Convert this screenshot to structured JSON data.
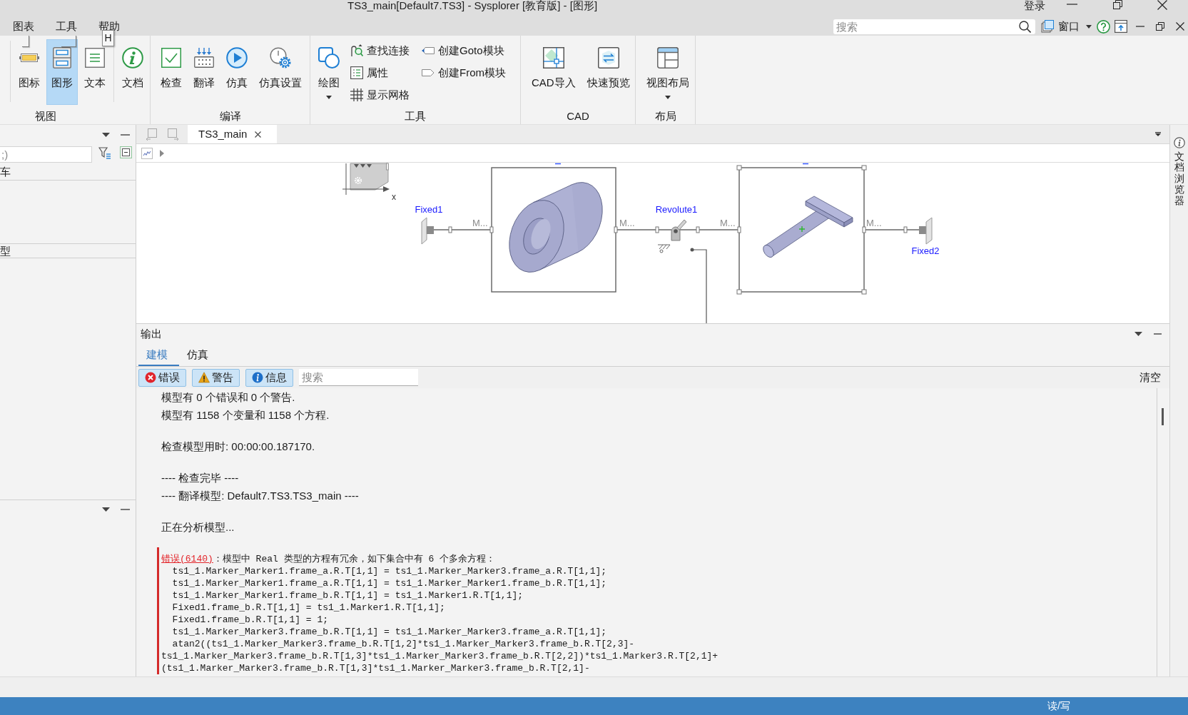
{
  "window": {
    "title": "TS3_main[Default7.TS3] - Sysplorer [教育版] - [图形]",
    "login": "登录"
  },
  "menu": [
    {
      "label": "图表"
    },
    {
      "label": "工具"
    },
    {
      "label": "帮助",
      "keytip": "H"
    }
  ],
  "quick_bar": {
    "search": {
      "placeholder": "搜索"
    },
    "window_menu": {
      "label": "窗口"
    }
  },
  "ribbon": {
    "groups": [
      {
        "label": "视图",
        "buttons": [
          {
            "label": "图标",
            "selected": false,
            "dropdown": false
          },
          {
            "label": "图形",
            "selected": true,
            "dropdown": false
          },
          {
            "label": "文本",
            "selected": false,
            "dropdown": false
          },
          {
            "label": "文档",
            "selected": false,
            "dropdown": false
          }
        ]
      },
      {
        "label": "编译",
        "buttons": [
          {
            "label": "检查",
            "dropdown": false
          },
          {
            "label": "翻译",
            "dropdown": false
          },
          {
            "label": "仿真",
            "dropdown": false
          },
          {
            "label": "仿真设置",
            "dropdown": false
          }
        ]
      },
      {
        "label": "工具",
        "buttons": [
          {
            "label": "绘图",
            "dropdown": true
          }
        ],
        "columns": [
          [
            {
              "label": "查找连接"
            },
            {
              "label": "属性"
            },
            {
              "label": "显示网格"
            }
          ],
          [
            {
              "label": "创建Goto模块"
            },
            {
              "label": "创建From模块"
            }
          ]
        ]
      },
      {
        "label": "CAD",
        "buttons": [
          {
            "label": "CAD导入",
            "dropdown": false
          },
          {
            "label": "快速预览",
            "dropdown": false
          }
        ]
      },
      {
        "label": "布局",
        "buttons": [
          {
            "label": "视图布局",
            "dropdown": true
          }
        ]
      }
    ]
  },
  "left_panel": {
    "search": {
      "placeholder": ";)"
    },
    "sections": [
      {
        "label": "车"
      },
      {
        "label": "型"
      }
    ]
  },
  "documents": {
    "tabs": [
      {
        "label": "TS3_main",
        "selected": true
      }
    ]
  },
  "diagram": {
    "axis_label": "x",
    "fixed": [
      {
        "label": "Fixed1"
      },
      {
        "label": "Fixed2"
      }
    ],
    "joint": {
      "label": "Revolute1"
    },
    "bodies": [
      {
        "selected": false
      },
      {
        "selected": true
      }
    ],
    "port_labels": [
      "M...",
      "M...",
      "M...",
      "M..."
    ]
  },
  "output": {
    "title": "输出",
    "tabs": [
      {
        "label": "建模",
        "selected": true
      },
      {
        "label": "仿真",
        "selected": false
      }
    ],
    "filters": [
      {
        "kind": "error",
        "label": "错误"
      },
      {
        "kind": "warning",
        "label": "警告"
      },
      {
        "kind": "info",
        "label": "信息"
      }
    ],
    "search": {
      "placeholder": "搜索"
    },
    "clear": "清空",
    "messages": [
      {
        "kind": "info",
        "lines": [
          "模型有 0 个错误和 0 个警告.",
          "模型有 1158 个变量和 1158 个方程."
        ]
      },
      {
        "kind": "info",
        "lines": [
          "检查模型用时: 00:00:00.187170."
        ]
      },
      {
        "kind": "info",
        "lines": [
          "---- 检查完毕 ----",
          "---- 翻译模型: Default7.TS3.TS3_main ----"
        ]
      },
      {
        "kind": "info",
        "lines": [
          "正在分析模型..."
        ]
      },
      {
        "kind": "error",
        "code": "错误(6140)",
        "text": "：模型中 Real 类型的方程有冗余，如下集合中有 6 个多余方程：",
        "lines": [
          "ts1_1.Marker_Marker1.frame_a.R.T[1,1] = ts1_1.Marker_Marker3.frame_a.R.T[1,1];",
          "ts1_1.Marker_Marker1.frame_a.R.T[1,1] = ts1_1.Marker_Marker1.frame_b.R.T[1,1];",
          "ts1_1.Marker_Marker1.frame_b.R.T[1,1] = ts1_1.Marker1.R.T[1,1];",
          "Fixed1.frame_b.R.T[1,1] = ts1_1.Marker1.R.T[1,1];",
          "Fixed1.frame_b.R.T[1,1] = 1;",
          "ts1_1.Marker_Marker3.frame_b.R.T[1,1] = ts1_1.Marker_Marker3.frame_a.R.T[1,1];",
          "atan2((ts1_1.Marker_Marker3.frame_b.R.T[1,2]*ts1_1.Marker_Marker3.frame_b.R.T[2,3]-\nts1_1.Marker_Marker3.frame_b.R.T[1,3]*ts1_1.Marker_Marker3.frame_b.R.T[2,2])*ts1_1.Marker3.R.T[2,1]+\n(ts1_1.Marker_Marker3.frame_b.R.T[1,3]*ts1_1.Marker_Marker3.frame_b.R.T[2,1]-"
        ]
      }
    ]
  },
  "dock": {
    "label": "文档浏览器"
  },
  "status_bar": {
    "mode": "读/写"
  }
}
